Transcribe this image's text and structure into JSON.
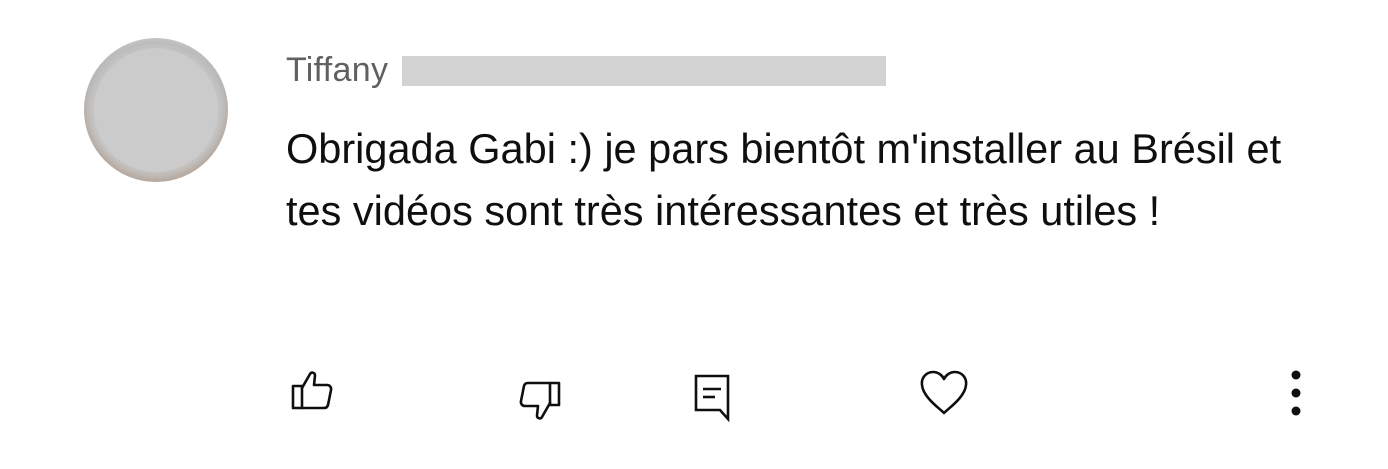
{
  "comment": {
    "author": {
      "name": "Tiffany",
      "name_redacted": true
    },
    "text": "Obrigada Gabi :) je pars bientôt m'installer au Brésil et tes vidéos sont très intéressantes et très utiles !",
    "actions": [
      {
        "name": "like",
        "icon": "thumbs-up-icon"
      },
      {
        "name": "dislike",
        "icon": "thumbs-down-icon"
      },
      {
        "name": "reply",
        "icon": "comment-icon"
      },
      {
        "name": "heart",
        "icon": "heart-icon"
      },
      {
        "name": "more",
        "icon": "more-vertical-icon"
      }
    ]
  },
  "colors": {
    "author_text": "#606060",
    "body_text": "#0f0f0f",
    "redaction": "#d3d3d3",
    "avatar_placeholder": "#cbcbcb"
  }
}
